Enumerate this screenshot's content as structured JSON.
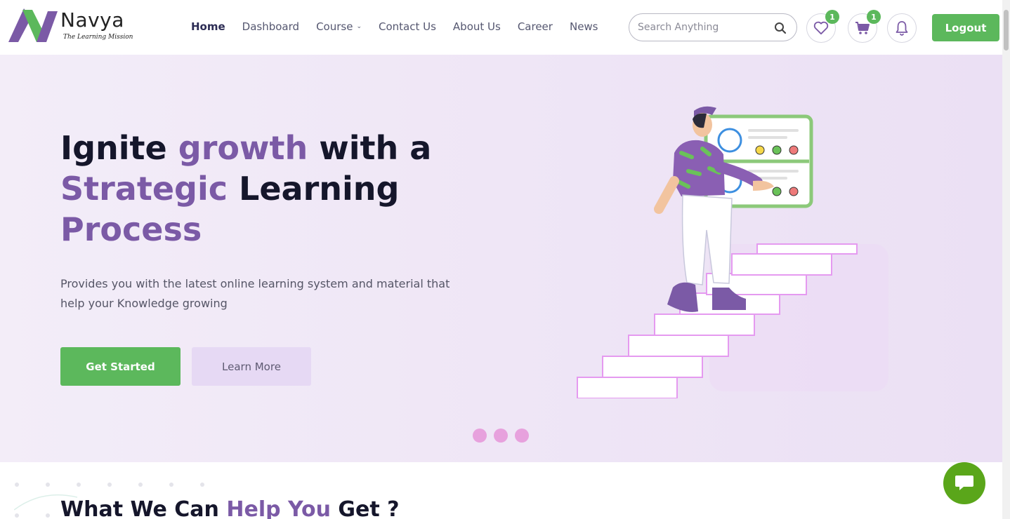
{
  "header": {
    "logo": {
      "title": "Navya",
      "subtitle": "The Learning Mission"
    },
    "nav": [
      {
        "label": "Home",
        "active": true
      },
      {
        "label": "Dashboard"
      },
      {
        "label": "Course",
        "has_dropdown": true
      },
      {
        "label": "Contact Us"
      },
      {
        "label": "About Us"
      },
      {
        "label": "Career"
      },
      {
        "label": "News"
      }
    ],
    "search": {
      "placeholder": "Search Anything",
      "icon": "search-icon"
    },
    "wishlist": {
      "icon": "heart-icon",
      "count": "1"
    },
    "cart": {
      "icon": "cart-icon",
      "count": "1"
    },
    "notifications": {
      "icon": "bell-icon"
    },
    "logout_label": "Logout"
  },
  "hero": {
    "title": {
      "part1": "Ignite ",
      "accent1": "growth",
      "part2": " with a",
      "accent2": "Strategic",
      "part3": " Learning",
      "accent3": "Process"
    },
    "description": "Provides you with the latest online learning system and material that help your Knowledge growing",
    "primary_button": "Get Started",
    "secondary_button": "Learn More",
    "carousel_dots": 3
  },
  "section": {
    "title_part1": "What We Can ",
    "title_accent": "Help You",
    "title_part2": " Get ?"
  },
  "colors": {
    "brand_purple": "#7b5aa6",
    "brand_green": "#5cb85c",
    "hero_bg": "#efe6f6",
    "dot": "#e7a1dd",
    "chat": "#5aa61a"
  }
}
